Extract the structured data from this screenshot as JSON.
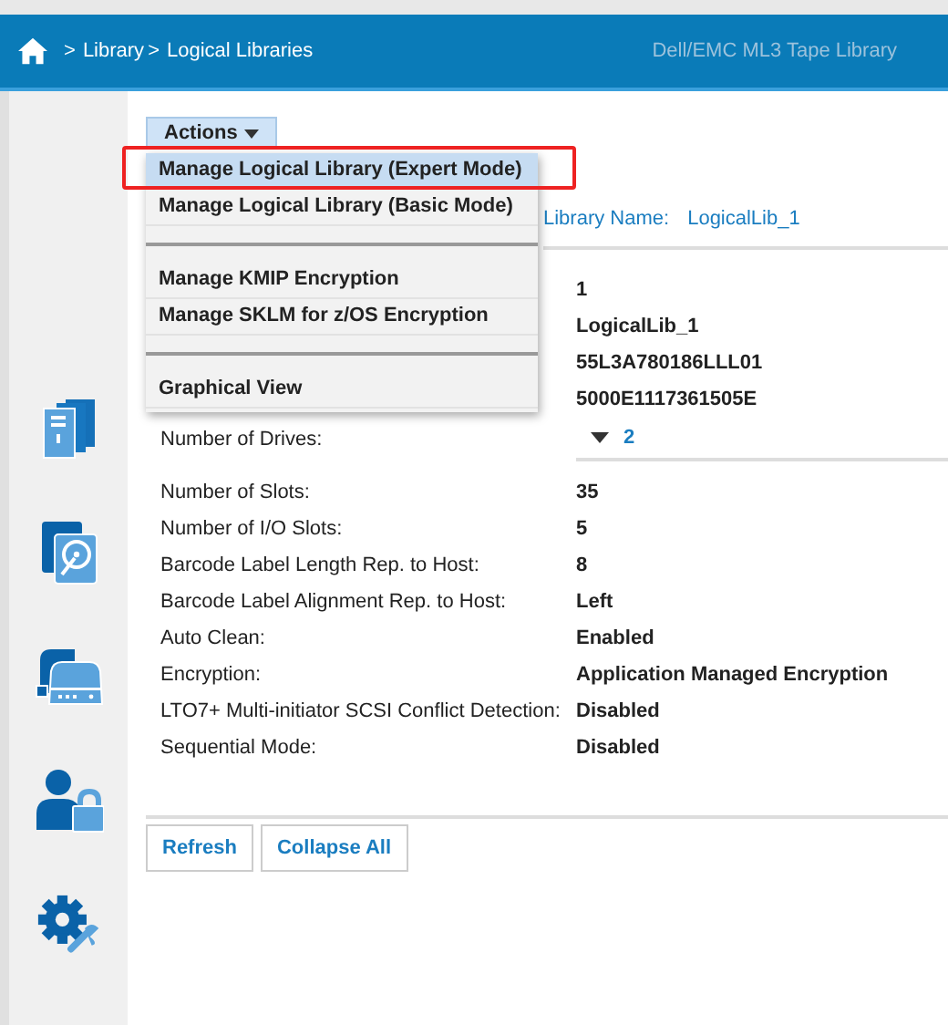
{
  "header": {
    "breadcrumb": [
      {
        "kind": "separator",
        "text": ">"
      },
      {
        "kind": "link",
        "text": "Library"
      },
      {
        "kind": "separator",
        "text": ">"
      },
      {
        "kind": "link",
        "text": "Logical Libraries"
      }
    ],
    "product": "Dell/EMC ML3 Tape Library"
  },
  "sidebar": {
    "items": [
      {
        "kind": "libraries"
      },
      {
        "kind": "drive"
      },
      {
        "kind": "storage"
      },
      {
        "kind": "access"
      },
      {
        "kind": "service"
      }
    ]
  },
  "actions": {
    "label": "Actions",
    "expanded": true,
    "menu": [
      {
        "kind": "item",
        "label": "Manage Logical Library (Expert Mode)",
        "selected": true
      },
      {
        "kind": "item",
        "label": "Manage Logical Library (Basic Mode)",
        "selected": false
      },
      {
        "kind": "separator"
      },
      {
        "kind": "item",
        "label": "Manage KMIP Encryption",
        "selected": false
      },
      {
        "kind": "item",
        "label": "Manage SKLM for z/OS Encryption",
        "selected": false
      },
      {
        "kind": "separator"
      },
      {
        "kind": "item",
        "label": "Graphical View",
        "selected": false
      }
    ]
  },
  "library_name": {
    "label": "Library Name:",
    "value": "LogicalLib_1"
  },
  "rows": [
    {
      "kind": "text",
      "value": "1"
    },
    {
      "kind": "text",
      "value": "LogicalLib_1"
    },
    {
      "kind": "text",
      "value": "55L3A780186LLL01"
    },
    {
      "kind": "text",
      "value": "5000E1117361505E"
    },
    {
      "kind": "expander",
      "label": "Number of Drives:",
      "value": "2",
      "expanded": false
    },
    {
      "kind": "text",
      "label": "Number of Slots:",
      "value": "35"
    },
    {
      "kind": "text",
      "label": "Number of I/O Slots:",
      "value": "5"
    },
    {
      "kind": "text",
      "label": "Barcode Label Length Rep. to Host:",
      "value": "8"
    },
    {
      "kind": "text",
      "label": "Barcode Label Alignment Rep. to Host:",
      "value": "Left"
    },
    {
      "kind": "text",
      "label": "Auto Clean:",
      "value": "Enabled"
    },
    {
      "kind": "text",
      "label": "Encryption:",
      "value": "Application Managed Encryption"
    },
    {
      "kind": "text",
      "label": "LTO7+ Multi-initiator SCSI Conflict Detection:",
      "value": "Disabled"
    },
    {
      "kind": "text",
      "label": "Sequential Mode:",
      "value": "Disabled"
    }
  ],
  "buttons": [
    "Refresh",
    "Collapse All"
  ]
}
